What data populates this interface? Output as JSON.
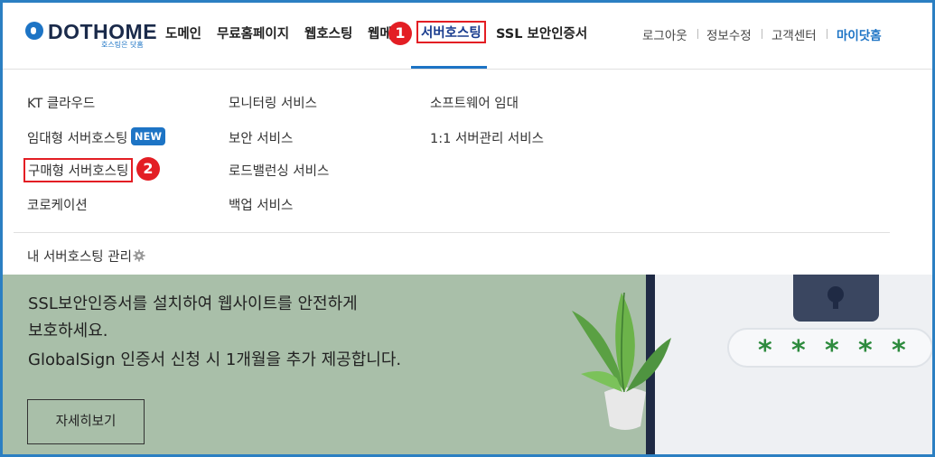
{
  "header": {
    "logo": {
      "name": "DOTHOME",
      "tagline": "호스팅은 닷홈"
    },
    "nav": [
      {
        "label": "도메인"
      },
      {
        "label": "무료홈페이지"
      },
      {
        "label": "웹호스팅"
      },
      {
        "label": "웹메"
      },
      {
        "label": "서버호스팅",
        "active": true
      },
      {
        "label": "SSL 보안인증서"
      }
    ],
    "util": {
      "logout": "로그아웃",
      "edit_info": "정보수정",
      "support": "고객센터",
      "myhome": "마이닷홈"
    },
    "step_badges": {
      "first": "1",
      "second": "2"
    }
  },
  "menu": {
    "col1": [
      {
        "label": "KT 클라우드"
      },
      {
        "label": "임대형 서버호스팅",
        "badge": "NEW"
      },
      {
        "label": "구매형 서버호스팅"
      },
      {
        "label": "코로케이션"
      }
    ],
    "col2": [
      {
        "label": "모니터링 서비스"
      },
      {
        "label": "보안 서비스"
      },
      {
        "label": "로드밸런싱 서비스"
      },
      {
        "label": "백업 서비스"
      }
    ],
    "col3": [
      {
        "label": "소프트웨어 임대"
      },
      {
        "label": "1:1 서버관리 서비스"
      }
    ],
    "manage": "내 서버호스팅 관리"
  },
  "banner": {
    "line1": "SSL보안인증서를 설치하여 웹사이트를 안전하게",
    "line2": "보호하세요.",
    "line3": "GlobalSign 인증서 신청 시 1개월을 추가 제공합니다.",
    "button": "자세히보기",
    "password_mask": "*****"
  },
  "colors": {
    "accent": "#1d74c5",
    "highlight": "#e31e24",
    "banner_bg": "#a9bfa9",
    "frame": "#2b7fc2"
  }
}
